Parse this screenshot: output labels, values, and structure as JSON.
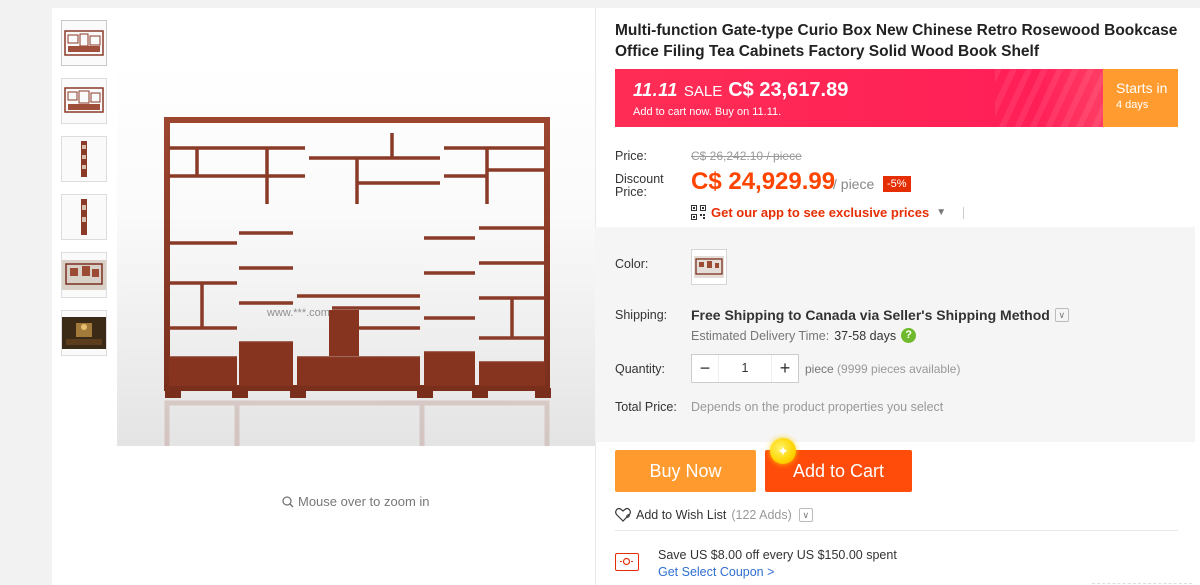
{
  "product": {
    "title": "Multi-function Gate-type Curio Box New Chinese Retro Rosewood Bookcase Office Filing Tea Cabinets Factory Solid Wood Book Shelf"
  },
  "promo": {
    "event": "11.11",
    "sale_label": "SALE",
    "sale_price": "C$ 23,617.89",
    "note": "Add to cart now. Buy on 11.11.",
    "starts_label": "Starts in",
    "starts_value": "4 days"
  },
  "pricing": {
    "price_label": "Price:",
    "original_price": "C$ 26,242.10 / piece",
    "discount_label": "Discount Price:",
    "discount_price": "C$ 24,929.99",
    "unit": "/ piece",
    "discount_badge": "-5%",
    "app_promo": "Get our app to see exclusive prices"
  },
  "options": {
    "color_label": "Color:",
    "shipping_label": "Shipping:",
    "shipping_method": "Free Shipping to Canada via Seller's Shipping Method",
    "delivery_label": "Estimated Delivery Time:",
    "delivery_days": "37-58 days",
    "quantity_label": "Quantity:",
    "quantity_value": "1",
    "quantity_unit": "piece",
    "quantity_available": "(9999 pieces available)",
    "total_label": "Total Price:",
    "total_note": "Depends on the product properties you select"
  },
  "actions": {
    "buy_now": "Buy Now",
    "add_to_cart": "Add to Cart",
    "wishlist": "Add to Wish List",
    "wishlist_count": "(122 Adds)"
  },
  "coupon": {
    "text": "Save US $8.00 off every US $150.00 spent",
    "link": "Get Select Coupon >"
  },
  "gallery": {
    "zoom_hint": "Mouse over to zoom in",
    "watermark": "www.***.com"
  },
  "colors": {
    "accent_orange": "#ff4c0a",
    "buy_orange": "#ff9a2e",
    "promo_pink": "#ff2d55",
    "discount_red": "#ff4400"
  }
}
